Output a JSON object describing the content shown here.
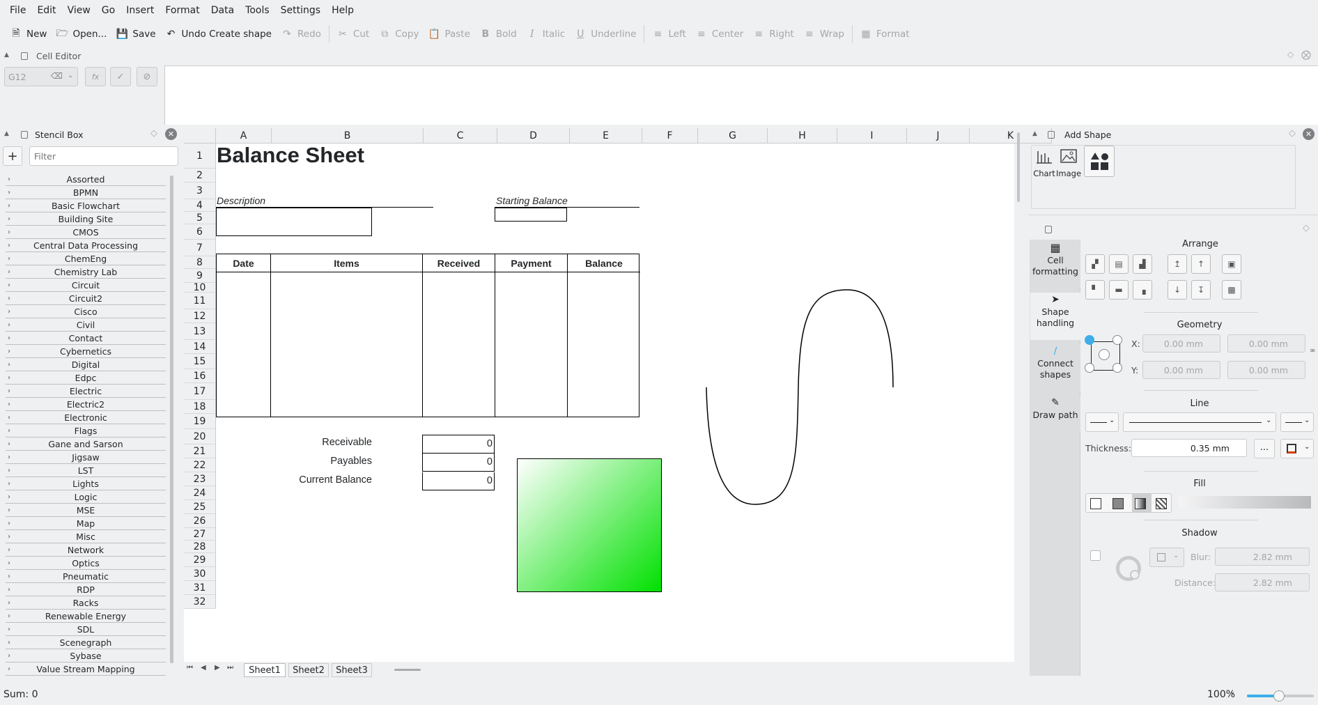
{
  "menu": [
    "File",
    "Edit",
    "View",
    "Go",
    "Insert",
    "Format",
    "Data",
    "Tools",
    "Settings",
    "Help"
  ],
  "toolbar": {
    "new": "New",
    "open": "Open...",
    "save": "Save",
    "undo": "Undo Create shape",
    "redo": "Redo",
    "cut": "Cut",
    "copy": "Copy",
    "paste": "Paste",
    "bold": "Bold",
    "italic": "Italic",
    "underline": "Underline",
    "left": "Left",
    "center": "Center",
    "right": "Right",
    "wrap": "Wrap",
    "format": "Format"
  },
  "cell_editor": {
    "title": "Cell Editor",
    "cell_ref": "G12",
    "fx": "fx"
  },
  "stencil": {
    "title": "Stencil Box",
    "filter_placeholder": "Filter",
    "items": [
      "Assorted",
      "BPMN",
      "Basic Flowchart",
      "Building Site",
      "CMOS",
      "Central Data Processing",
      "ChemEng",
      "Chemistry Lab",
      "Circuit",
      "Circuit2",
      "Cisco",
      "Civil",
      "Contact",
      "Cybernetics",
      "Digital",
      "Edpc",
      "Electric",
      "Electric2",
      "Electronic",
      "Flags",
      "Gane and Sarson",
      "Jigsaw",
      "LST",
      "Lights",
      "Logic",
      "MSE",
      "Map",
      "Misc",
      "Network",
      "Optics",
      "Pneumatic",
      "RDP",
      "Racks",
      "Renewable Energy",
      "SDL",
      "Scenegraph",
      "Sybase",
      "Value Stream Mapping"
    ]
  },
  "sheet": {
    "columns": [
      "A",
      "B",
      "C",
      "D",
      "E",
      "F",
      "G",
      "H",
      "I",
      "J",
      "K"
    ],
    "rows": [
      "1",
      "2",
      "3",
      "4",
      "5",
      "6",
      "7",
      "8",
      "9",
      "10",
      "11",
      "12",
      "13",
      "14",
      "15",
      "16",
      "17",
      "18",
      "19",
      "20",
      "21",
      "22",
      "23",
      "24",
      "25",
      "26",
      "27",
      "28",
      "29",
      "30",
      "31",
      "32"
    ],
    "title": "Balance Sheet",
    "description_label": "Description",
    "starting_balance_label": "Starting Balance",
    "table_headers": [
      "Date",
      "Items",
      "Received",
      "Payment",
      "Balance"
    ],
    "summary": [
      {
        "label": "Receivable",
        "value": "0"
      },
      {
        "label": "Payables",
        "value": "0"
      },
      {
        "label": "Current Balance",
        "value": "0"
      }
    ],
    "tabs": [
      "Sheet1",
      "Sheet2",
      "Sheet3"
    ],
    "active_tab": "Sheet1"
  },
  "add_shape": {
    "title": "Add Shape",
    "chart": "Chart",
    "image": "Image"
  },
  "tools": {
    "tabs": [
      "Cell formatting",
      "Shape handling",
      "Connect shapes",
      "Draw path"
    ],
    "arrange": "Arrange",
    "geometry": "Geometry",
    "x_label": "X:",
    "y_label": "Y:",
    "x_value": "0.00 mm",
    "y_value": "0.00 mm",
    "w_value": "0.00 mm",
    "h_value": "0.00 mm",
    "line": "Line",
    "thickness_label": "Thickness:",
    "thickness_value": "0.35 mm",
    "more": "...",
    "fill": "Fill",
    "shadow": "Shadow",
    "blur_label": "Blur:",
    "blur_value": "2.82 mm",
    "distance_label": "Distance:",
    "distance_value": "2.82 mm"
  },
  "status": {
    "sum": "Sum: 0",
    "zoom": "100%",
    "zoom_level_percent": 100
  },
  "colors": {
    "gradient_start": "#ffffff",
    "gradient_end": "#00e000",
    "accent": "#3daee9"
  }
}
